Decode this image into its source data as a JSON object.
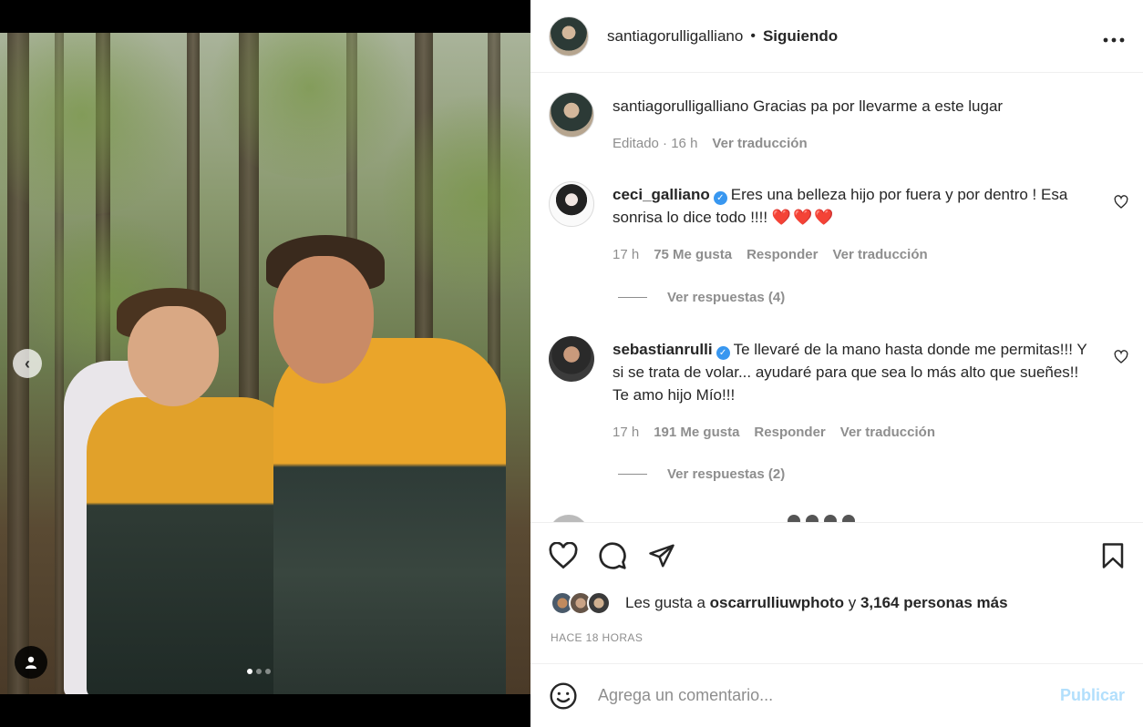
{
  "post": {
    "owner": "santiagorulligalliano",
    "separator": "•",
    "follow_status": "Siguiendo",
    "more_icon": "more-horizontal-icon",
    "carousel": {
      "slide_count": 3,
      "active_index": 0
    }
  },
  "caption": {
    "username": "santiagorulligalliano",
    "text": "Gracias pa por llevarme a este lugar",
    "edited": "Editado",
    "time": "16 h",
    "translate": "Ver traducción"
  },
  "comments": [
    {
      "username": "ceci_galliano",
      "verified": true,
      "text": "Eres una belleza hijo por fuera y por dentro ! Esa sonrisa lo dice todo !!!!",
      "emoji": "❤️❤️❤️",
      "time": "17 h",
      "likes": "75 Me gusta",
      "reply": "Responder",
      "translate": "Ver traducción",
      "replies": "Ver respuestas (4)"
    },
    {
      "username": "sebastianrulli",
      "verified": true,
      "text": "Te llevaré de la mano hasta donde me permitas!!! Y si se trata de volar... ayudaré para que sea lo más alto que sueñes!! Te amo hijo Mío!!!",
      "time": "17 h",
      "likes": "191 Me gusta",
      "reply": "Responder",
      "translate": "Ver traducción",
      "replies": "Ver respuestas (2)"
    }
  ],
  "likes_summary": {
    "prefix": "Les gusta a",
    "user": "oscarrulliuwphoto",
    "joiner": "y",
    "others": "3,164 personas más"
  },
  "timestamp": "HACE 18 HORAS",
  "composer": {
    "placeholder": "Agrega un comentario...",
    "publish": "Publicar"
  },
  "colors": {
    "verified": "#3897f0",
    "publish_disabled": "#b2dffc",
    "muted": "#8e8e8e"
  }
}
